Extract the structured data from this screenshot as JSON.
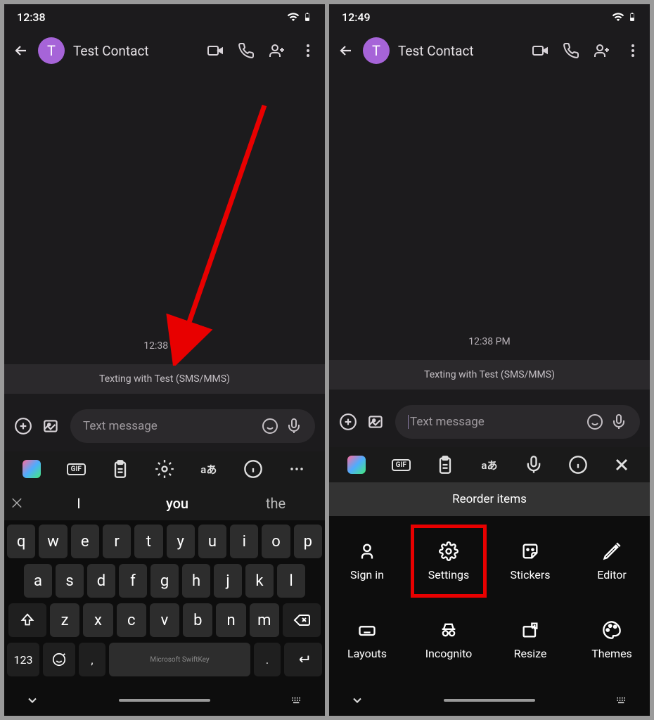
{
  "left": {
    "status_time": "12:38",
    "contact_initial": "T",
    "contact_name": "Test Contact",
    "timestamp": "12:38 PM",
    "info_text": "Texting with Test (SMS/MMS)",
    "placeholder": "Text message",
    "suggestions": [
      "I",
      "you",
      "the"
    ],
    "keyboard_brand": "Microsoft SwiftKey",
    "num_key": "123"
  },
  "right": {
    "status_time": "12:49",
    "contact_initial": "T",
    "contact_name": "Test Contact",
    "timestamp": "12:38 PM",
    "info_text": "Texting with Test (SMS/MMS)",
    "placeholder": "Text message",
    "reorder_title": "Reorder items",
    "grid": [
      {
        "label": "Sign in"
      },
      {
        "label": "Settings",
        "highlighted": true
      },
      {
        "label": "Stickers"
      },
      {
        "label": "Editor"
      },
      {
        "label": "Layouts"
      },
      {
        "label": "Incognito"
      },
      {
        "label": "Resize"
      },
      {
        "label": "Themes"
      }
    ]
  },
  "keys": {
    "row1": [
      "q",
      "w",
      "e",
      "r",
      "t",
      "y",
      "u",
      "i",
      "o",
      "p"
    ],
    "row2": [
      "a",
      "s",
      "d",
      "f",
      "g",
      "h",
      "j",
      "k",
      "l"
    ],
    "row3": [
      "z",
      "x",
      "c",
      "v",
      "b",
      "n",
      "m"
    ]
  }
}
